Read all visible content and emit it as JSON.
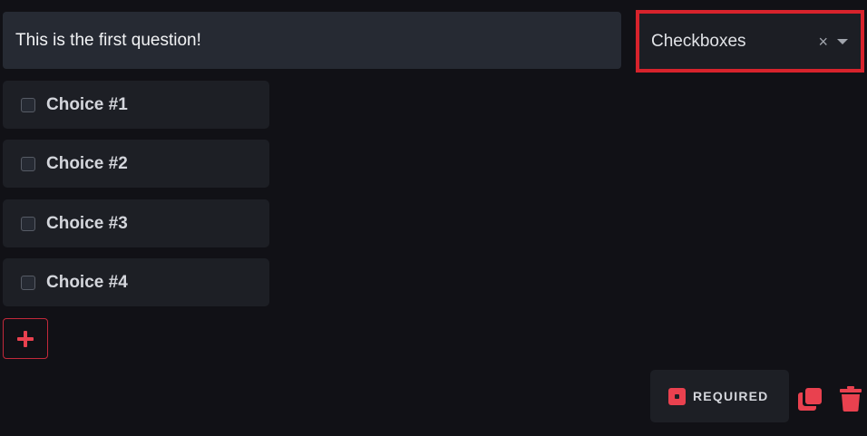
{
  "question": {
    "text": "This is the first question!"
  },
  "type_select": {
    "value": "Checkboxes",
    "clear_symbol": "×",
    "icons": [
      "clear-icon",
      "chevron-down-icon"
    ]
  },
  "choices": [
    {
      "label": "Choice #1",
      "checked": false
    },
    {
      "label": "Choice #2",
      "checked": false
    },
    {
      "label": "Choice #3",
      "checked": false
    },
    {
      "label": "Choice #4",
      "checked": false
    }
  ],
  "add_choice": {
    "icon": "plus-icon"
  },
  "footer": {
    "required_label": "REQUIRED",
    "duplicate_icon": "copy-icon",
    "delete_icon": "trash-icon"
  },
  "colors": {
    "accent": "#e9414f",
    "highlight_border": "#d7232c",
    "background": "#111116",
    "panel": "#262a33"
  }
}
